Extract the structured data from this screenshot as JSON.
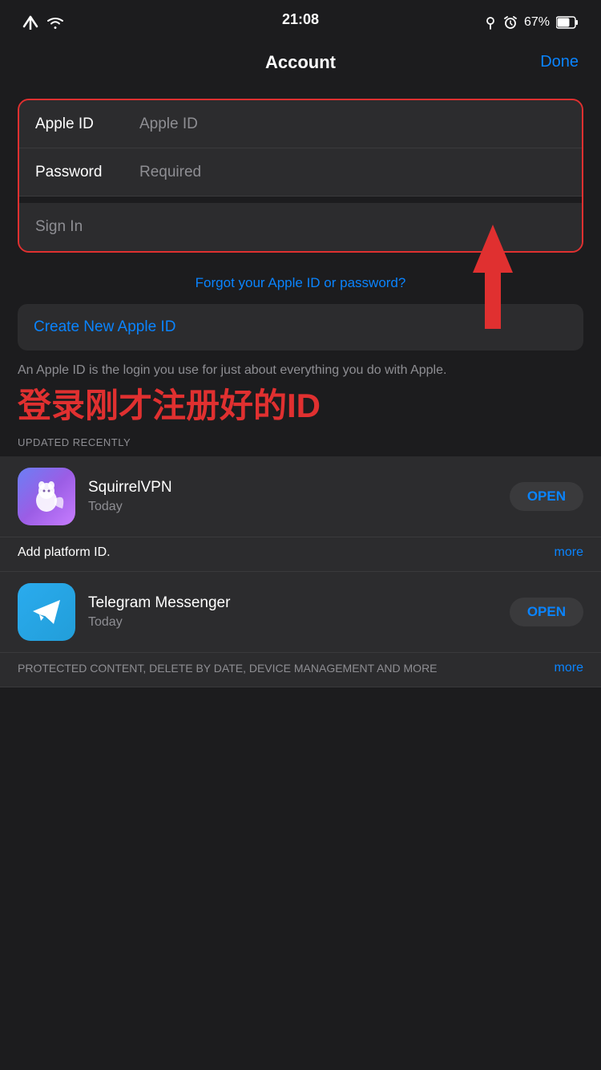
{
  "statusBar": {
    "time": "21:08",
    "battery": "67%",
    "icons": [
      "arrow-up-right",
      "wifi",
      "location",
      "alarm"
    ]
  },
  "navBar": {
    "title": "Account",
    "doneLabel": "Done"
  },
  "form": {
    "appleIdLabel": "Apple ID",
    "appleIdPlaceholder": "Apple ID",
    "passwordLabel": "Password",
    "passwordPlaceholder": "Required",
    "signInLabel": "Sign In"
  },
  "forgotLink": "Forgot your Apple ID or password?",
  "createButton": "Create New Apple ID",
  "descriptionText": "An Apple ID is the login you use for just about everything you do with Apple.",
  "chineseAnnotation": "登录刚才注册好的ID",
  "updatedLabel": "UPDATED RECENTLY",
  "apps": [
    {
      "name": "SquirrelVPN",
      "date": "Today",
      "openLabel": "OPEN",
      "description": "Add platform ID.",
      "moreLabel": "more",
      "iconType": "squirrel"
    },
    {
      "name": "Telegram Messenger",
      "date": "Today",
      "openLabel": "OPEN",
      "description": "PROTECTED CONTENT, DELETE BY DATE, DEVICE MANAGEMENT AND MORE",
      "moreLabel": "more",
      "iconType": "telegram"
    }
  ]
}
